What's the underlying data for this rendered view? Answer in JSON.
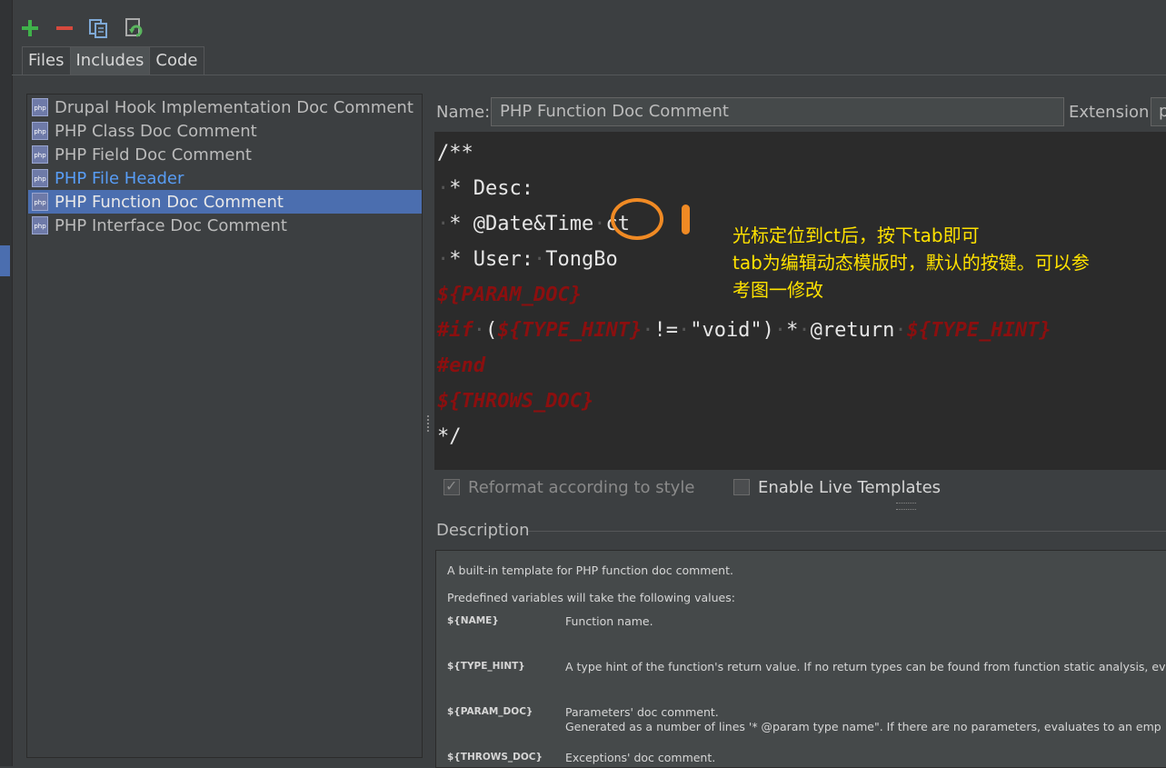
{
  "toolbar": {
    "icons": [
      "plus-icon",
      "minus-icon",
      "copy-icon",
      "reset-icon"
    ],
    "colors": {
      "plus": "#3fb24a",
      "minus": "#d6493d",
      "copy": "#7fa9d6",
      "reset": "#5ab55e"
    }
  },
  "tabs": [
    {
      "label": "Files",
      "active": false
    },
    {
      "label": "Includes",
      "active": true
    },
    {
      "label": "Code",
      "active": false
    }
  ],
  "templates": [
    {
      "label": "Drupal Hook Implementation Doc Comment",
      "selected": false,
      "link": false
    },
    {
      "label": "PHP Class Doc Comment",
      "selected": false,
      "link": false
    },
    {
      "label": "PHP Field Doc Comment",
      "selected": false,
      "link": false
    },
    {
      "label": "PHP File Header",
      "selected": false,
      "link": true
    },
    {
      "label": "PHP Function Doc Comment",
      "selected": true,
      "link": false
    },
    {
      "label": "PHP Interface Doc Comment",
      "selected": false,
      "link": false
    }
  ],
  "icon_text": "php",
  "form": {
    "name_label": "Name:",
    "name_value": "PHP Function Doc Comment",
    "extension_label": "Extension:",
    "extension_value": "p"
  },
  "editor": {
    "line1": "/**",
    "line2_star": "*",
    "line2_text": " Desc:",
    "line3_star": "*",
    "line3_text": " @Date&Time",
    "line3_tail": "ct",
    "line4_star": "*",
    "line4_text": " User:",
    "line4_tail": "TongBo",
    "line5": "${PARAM_DOC}",
    "line6_if": "#if",
    "line6_open": "(",
    "line6_var": "${TYPE_HINT}",
    "line6_ne": "!=",
    "line6_void": "\"void\")",
    "line6_star": "*",
    "line6_ret": "@return",
    "line6_var2": "${TYPE_HINT}",
    "line7": "#end",
    "line8": "${THROWS_DOC}",
    "line9": "*/"
  },
  "annotation": {
    "line1": "光标定位到ct后，按下tab即可",
    "line2": "tab为编辑动态模版时，默认的按键。可以参",
    "line3": "考图一修改"
  },
  "options": {
    "reformat_label": "Reformat according to style",
    "reformat_checked": true,
    "live_templates_label": "Enable Live Templates",
    "live_templates_checked": false
  },
  "description": {
    "title": "Description",
    "intro": "A built-in template for PHP function doc comment.",
    "predefined": "Predefined variables will take the following values:",
    "variables": [
      {
        "name": "${NAME}",
        "desc": "Function name.",
        "desc2": ""
      },
      {
        "name": "${TYPE_HINT}",
        "desc": "A type hint of the function's return value. If no return types can be found from function static analysis, ev",
        "desc2": ""
      },
      {
        "name": "${PARAM_DOC}",
        "desc": "Parameters' doc comment.",
        "desc2": "Generated as a number of lines '* @param type name\". If there are no parameters, evaluates to an emp"
      },
      {
        "name": "${THROWS_DOC}",
        "desc": "Exceptions' doc comment.",
        "desc2": ""
      }
    ]
  }
}
